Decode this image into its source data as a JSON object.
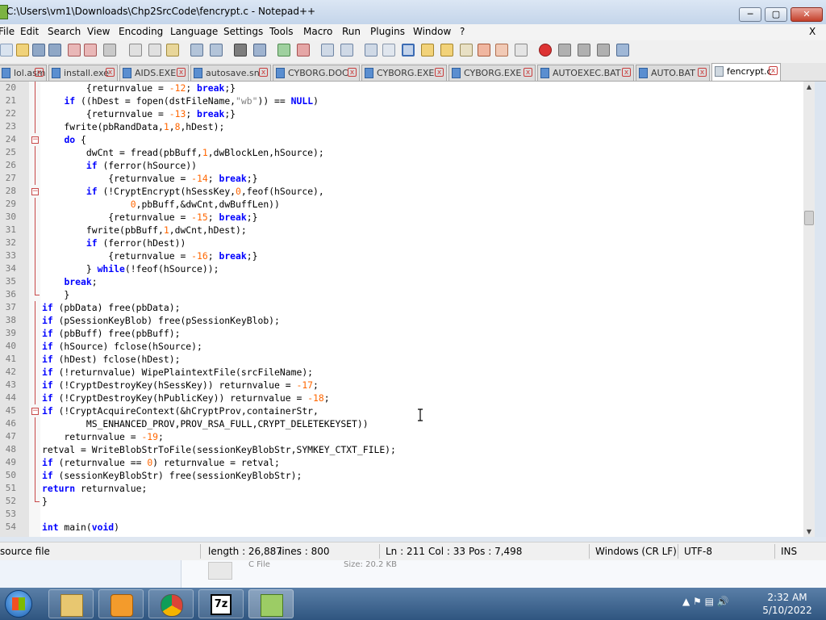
{
  "window": {
    "title": "C:\\Users\\vm1\\Downloads\\Chp2SrcCode\\fencrypt.c - Notepad++",
    "min": "─",
    "max": "▢",
    "close": "✕"
  },
  "menu": [
    "File",
    "Edit",
    "Search",
    "View",
    "Encoding",
    "Language",
    "Settings",
    "Tools",
    "Macro",
    "Run",
    "Plugins",
    "Window",
    "?"
  ],
  "menu_close": "X",
  "tabs": [
    {
      "label": "lol.asm",
      "close": "x"
    },
    {
      "label": "install.exe",
      "close": "x"
    },
    {
      "label": "AIDS.EXE",
      "close": "x"
    },
    {
      "label": "autosave.sn",
      "close": "x"
    },
    {
      "label": "CYBORG.DOC",
      "close": "x"
    },
    {
      "label": "CYBORG.EXE",
      "close": "x"
    },
    {
      "label": "CYBORG.EXE",
      "close": "x"
    },
    {
      "label": "AUTOEXEC.BAT",
      "close": "x"
    },
    {
      "label": "AUTO.BAT",
      "close": "x"
    },
    {
      "label": "fencrypt.c",
      "close": "x"
    }
  ],
  "code_lines": [
    {
      "num": "20",
      "html": "        {returnvalue = <span class=\"num\">-12</span>; <span class=\"kw\">break</span>;}"
    },
    {
      "num": "21",
      "html": "    <span class=\"kw\">if</span> ((hDest = fopen(dstFileName,<span class=\"str\">\"wb\"</span>)) == <span class=\"kw\">NULL</span>)"
    },
    {
      "num": "22",
      "html": "        {returnvalue = <span class=\"num\">-13</span>; <span class=\"kw\">break</span>;}"
    },
    {
      "num": "23",
      "html": "    fwrite(pbRandData,<span class=\"num\">1</span>,<span class=\"num\">8</span>,hDest);"
    },
    {
      "num": "24",
      "html": "    <span class=\"kw\">do</span> {"
    },
    {
      "num": "25",
      "html": "        dwCnt = fread(pbBuff,<span class=\"num\">1</span>,dwBlockLen,hSource);"
    },
    {
      "num": "26",
      "html": "        <span class=\"kw\">if</span> (ferror(hSource))"
    },
    {
      "num": "27",
      "html": "            {returnvalue = <span class=\"num\">-14</span>; <span class=\"kw\">break</span>;}"
    },
    {
      "num": "28",
      "html": "        <span class=\"kw\">if</span> (!CryptEncrypt(hSessKey,<span class=\"num\">0</span>,feof(hSource),"
    },
    {
      "num": "29",
      "html": "                <span class=\"num\">0</span>,pbBuff,&amp;dwCnt,dwBuffLen))"
    },
    {
      "num": "30",
      "html": "            {returnvalue = <span class=\"num\">-15</span>; <span class=\"kw\">break</span>;}"
    },
    {
      "num": "31",
      "html": "        fwrite(pbBuff,<span class=\"num\">1</span>,dwCnt,hDest);"
    },
    {
      "num": "32",
      "html": "        <span class=\"kw\">if</span> (ferror(hDest))"
    },
    {
      "num": "33",
      "html": "            {returnvalue = <span class=\"num\">-16</span>; <span class=\"kw\">break</span>;}"
    },
    {
      "num": "34",
      "html": "        } <span class=\"kw\">while</span>(!feof(hSource));"
    },
    {
      "num": "35",
      "html": "    <span class=\"kw\">break</span>;"
    },
    {
      "num": "36",
      "html": "    }"
    },
    {
      "num": "37",
      "html": "<span class=\"kw\">if</span> (pbData) free(pbData);"
    },
    {
      "num": "38",
      "html": "<span class=\"kw\">if</span> (pSessionKeyBlob) free(pSessionKeyBlob);"
    },
    {
      "num": "39",
      "html": "<span class=\"kw\">if</span> (pbBuff) free(pbBuff);"
    },
    {
      "num": "40",
      "html": "<span class=\"kw\">if</span> (hSource) fclose(hSource);"
    },
    {
      "num": "41",
      "html": "<span class=\"kw\">if</span> (hDest) fclose(hDest);"
    },
    {
      "num": "42",
      "html": "<span class=\"kw\">if</span> (!returnvalue) WipePlaintextFile(srcFileName);"
    },
    {
      "num": "43",
      "html": "<span class=\"kw\">if</span> (!CryptDestroyKey(hSessKey)) returnvalue = <span class=\"num\">-17</span>;"
    },
    {
      "num": "44",
      "html": "<span class=\"kw\">if</span> (!CryptDestroyKey(hPublicKey)) returnvalue = <span class=\"num\">-18</span>;"
    },
    {
      "num": "45",
      "html": "<span class=\"kw\">if</span> (!CryptAcquireContext(&amp;hCryptProv,containerStr,"
    },
    {
      "num": "46",
      "html": "        MS_ENHANCED_PROV,PROV_RSA_FULL,CRYPT_DELETEKEYSET))"
    },
    {
      "num": "47",
      "html": "    returnvalue = <span class=\"num\">-19</span>;"
    },
    {
      "num": "48",
      "html": "retval = WriteBlobStrToFile(sessionKeyBlobStr,SYMKEY_CTXT_FILE);"
    },
    {
      "num": "49",
      "html": "<span class=\"kw\">if</span> (returnvalue == <span class=\"num\">0</span>) returnvalue = retval;"
    },
    {
      "num": "50",
      "html": "<span class=\"kw\">if</span> (sessionKeyBlobStr) free(sessionKeyBlobStr);"
    },
    {
      "num": "51",
      "html": "<span class=\"kw\">return</span> returnvalue;"
    },
    {
      "num": "52",
      "html": "}"
    },
    {
      "num": "53",
      "html": ""
    },
    {
      "num": "54",
      "html": "<span class=\"kw\">int</span> main(<span class=\"kw\">void</span>)"
    }
  ],
  "status": {
    "type": "source file",
    "length": "length : 26,887",
    "lines": "lines : 800",
    "ln": "Ln : 211",
    "col": "Col : 33",
    "pos": "Pos : 7,498",
    "eol": "Windows (CR LF)",
    "encoding": "UTF-8",
    "mode": "INS"
  },
  "behind": {
    "col1": "C File",
    "col2": "Size: 20.2 KB"
  },
  "taskbar": {
    "time": "2:32 AM",
    "date": "5/10/2022",
    "tray_arrow": "▲"
  }
}
